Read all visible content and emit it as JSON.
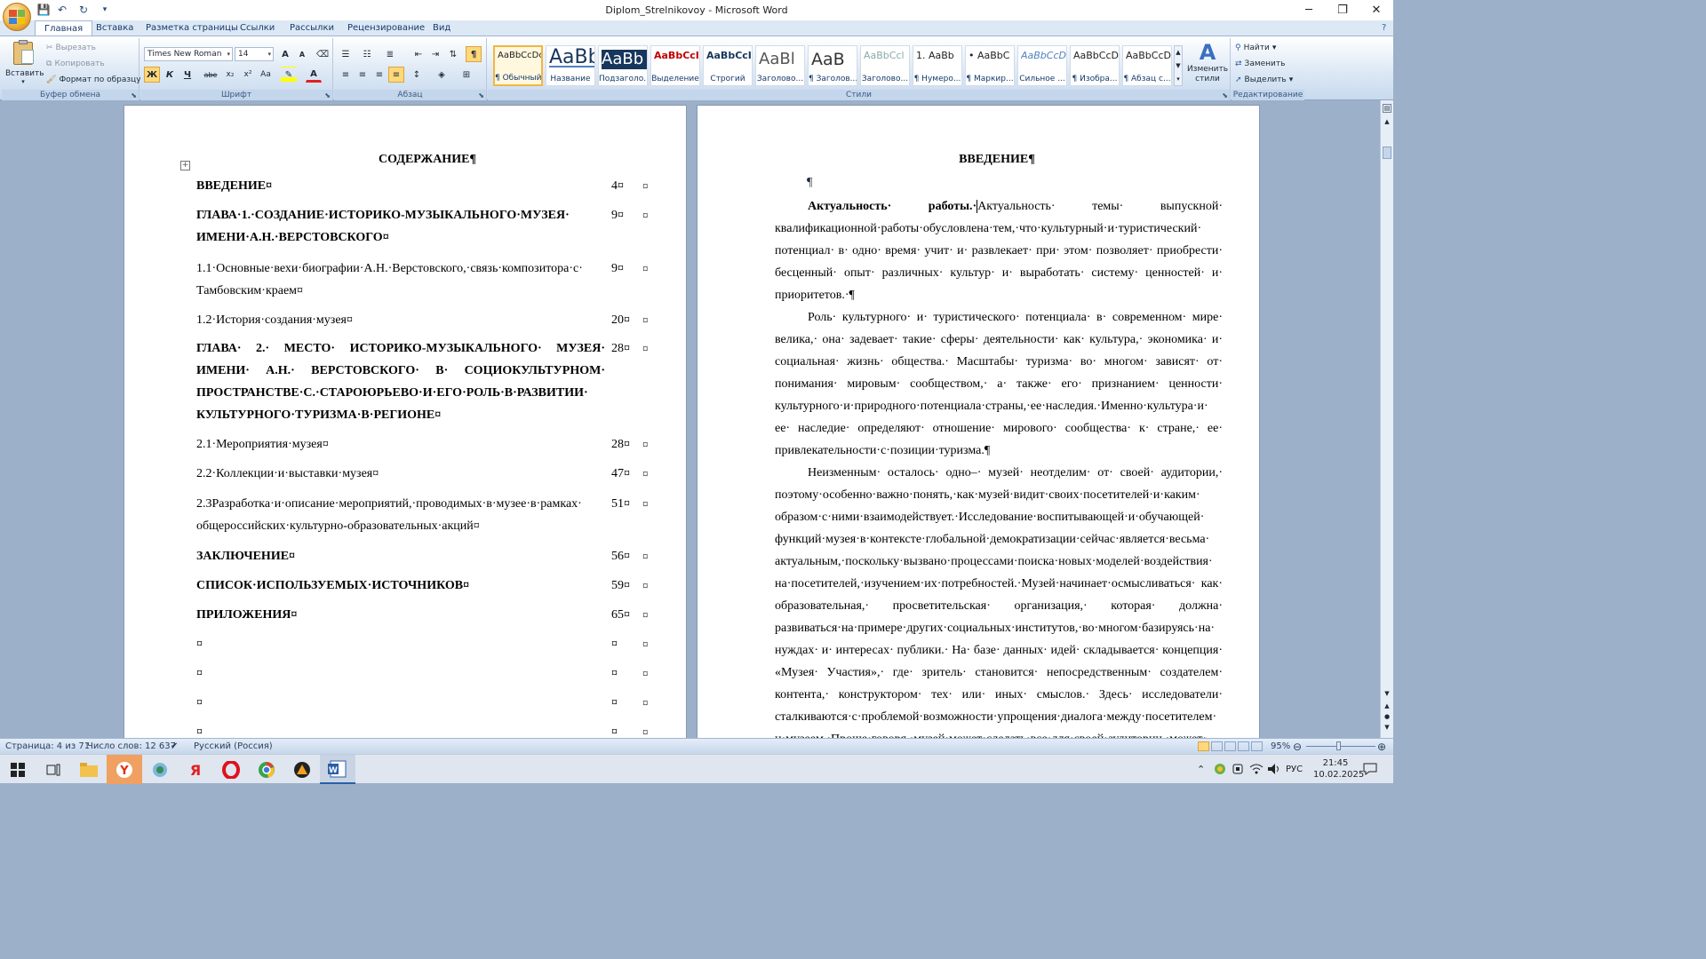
{
  "window": {
    "title": "Diplom_Strelnikovoy - Microsoft Word",
    "minimize_glyph": "─",
    "restore_glyph": "❐",
    "close_glyph": "✕",
    "qat_save": "💾",
    "qat_undo": "↶",
    "qat_redo": "↻",
    "qat_more": "▾"
  },
  "tabs": [
    {
      "label": "Главная",
      "active": true
    },
    {
      "label": "Вставка"
    },
    {
      "label": "Разметка страницы"
    },
    {
      "label": "Ссылки"
    },
    {
      "label": "Рассылки"
    },
    {
      "label": "Рецензирование"
    },
    {
      "label": "Вид"
    }
  ],
  "clipboard": {
    "group_label": "Буфер обмена",
    "paste": "Вставить",
    "cut": "Вырезать",
    "copy": "Копировать",
    "format_painter": "Формат по образцу"
  },
  "font": {
    "group_label": "Шрифт",
    "font_name": "Times New Roman",
    "font_size": "14",
    "grow": "A",
    "shrink": "A",
    "bold": "Ж",
    "italic": "К",
    "underline": "Ч",
    "strike": "abe",
    "sub": "x₂",
    "sup": "x²",
    "case": "Aa",
    "color": "A"
  },
  "paragraph": {
    "group_label": "Абзац",
    "pilcrow": "¶"
  },
  "styles": {
    "group_label": "Стили",
    "change_styles": "Изменить стили",
    "items": [
      {
        "sample": "AaBbCcDc",
        "name": "¶ Обычный"
      },
      {
        "sample": "AaBb",
        "name": "Название"
      },
      {
        "sample": "AaBb",
        "name": "Подзаголо..."
      },
      {
        "sample": "AaBbCcI",
        "name": "Выделение"
      },
      {
        "sample": "AaBbCcI",
        "name": "Строгий"
      },
      {
        "sample": "AaBl",
        "name": "Заголово..."
      },
      {
        "sample": "AaB",
        "name": "¶ Заголов..."
      },
      {
        "sample": "AaBbCcl",
        "name": "Заголово..."
      },
      {
        "sample": "1. AaBb",
        "name": "¶ Нумеро..."
      },
      {
        "sample": "• AaBbC",
        "name": "¶ Маркир..."
      },
      {
        "sample": "AaBbCcD",
        "name": "Сильное ..."
      },
      {
        "sample": "AaBbCcD",
        "name": "¶ Изобра..."
      },
      {
        "sample": "AaBbCcD",
        "name": "¶ Абзац с..."
      }
    ]
  },
  "editing": {
    "group_label": "Редактирование",
    "find": "Найти",
    "replace": "Заменить",
    "select": "Выделить"
  },
  "left_page": {
    "heading": "СОДЕРЖАНИЕ¶",
    "toc": [
      {
        "text": "ВВЕДЕНИЕ¤",
        "page": "4¤",
        "bold": true
      },
      {
        "text": "ГЛАВА·1.·СОЗДАНИЕ·ИСТОРИКО-МУЗЫКАЛЬНОГО·МУЗЕЯ· ИМЕНИ·А.Н.·ВЕРСТОВСКОГО¤",
        "page": "9¤",
        "bold": true
      },
      {
        "text": "1.1·Основные·вехи·биографии·А.Н.·Верстовского,·связь·композитора·с· Тамбовским·краем¤",
        "page": "9¤",
        "bold": false
      },
      {
        "text": "1.2·История·создания·музея¤",
        "page": "20¤",
        "bold": false
      },
      {
        "text": "ГЛАВА· 2.· МЕСТО· ИСТОРИКО-МУЗЫКАЛЬНОГО· МУЗЕЯ· ИМЕНИ· А.Н.· ВЕРСТОВСКОГО· В· СОЦИОКУЛЬТУРНОМ· ПРОСТРАНСТВЕ·С.·СТАРОЮРЬЕВО·И·ЕГО·РОЛЬ·В·РАЗВИТИИ· КУЛЬТУРНОГО·ТУРИЗМА·В·РЕГИОНЕ¤",
        "page": "28¤",
        "bold": true
      },
      {
        "text": "2.1·Мероприятия·музея¤",
        "page": "28¤",
        "bold": false
      },
      {
        "text": "2.2·Коллекции·и·выставки·музея¤",
        "page": "47¤",
        "bold": false
      },
      {
        "text": "2.3Разработка·и·описание·мероприятий,·проводимых·в·музее·в·рамках· общероссийских·культурно-образовательных·акций¤",
        "page": "51¤",
        "bold": false
      },
      {
        "text": "ЗАКЛЮЧЕНИЕ¤",
        "page": "56¤",
        "bold": true
      },
      {
        "text": "СПИСОК·ИСПОЛЬЗУЕМЫХ·ИСТОЧНИКОВ¤",
        "page": "59¤",
        "bold": true
      },
      {
        "text": "ПРИЛОЖЕНИЯ¤",
        "page": "65¤",
        "bold": true
      },
      {
        "text": "¤",
        "page": "¤",
        "bold": false
      },
      {
        "text": "¤",
        "page": "¤",
        "bold": false
      },
      {
        "text": "¤",
        "page": "¤",
        "bold": false
      },
      {
        "text": "¤",
        "page": "¤",
        "bold": false
      }
    ],
    "end_cell": "¤"
  },
  "right_page": {
    "heading": "ВВЕДЕНИЕ¶",
    "empty_para": "¶",
    "p1_bold": "Актуальность· работы.·",
    "p1": "Актуальность· темы· выпускной· квалификационной·работы·обусловлена·тем,·что·культурный·и·туристический· потенциал· в· одно· время· учит· и· развлекает· при· этом· позволяет· приобрести· бесценный· опыт· различных· культур· и· выработать· систему· ценностей· и· приоритетов.·¶",
    "p2": "Роль· культурного· и· туристического· потенциала· в· современном· мире· велика,· она· задевает· такие· сферы· деятельности· как· культура,· экономика· и· социальная· жизнь· общества.· Масштабы· туризма· во· многом· зависят· от· понимания· мировым· сообществом,· а· также· его· признанием· ценности· культурного·и·природного·потенциала·страны,·ее·наследия.·Именно·культура·и· ее· наследие· определяют· отношение· мирового· сообщества· к· стране,· ее· привлекательности·с·позиции·туризма.¶",
    "p3": "Неизменным· осталось· одно–· музей· неотделим· от· своей· аудитории,· поэтому·особенно·важно·понять,·как·музей·видит·своих·посетителей·и·каким· образом·с·ними·взаимодействует.·Исследование·воспитывающей·и·обучающей· функций·музея·в·контексте·глобальной·демократизации·сейчас·является·весьма· актуальным,·поскольку·вызвано·процессами·поиска·новых·моделей·воздействия· на·посетителей,·изучением·их·потребностей.·Музей·начинает·осмысливаться· как· образовательная,· просветительская· организация,· которая· должна· развиваться·на·примере·других·социальных·институтов,·во·многом·базируясь·на· нуждах· и· интересах· публики.· На· базе· данных· идей· складывается· концепция· «Музея· Участия»,· где· зритель· становится· непосредственным· создателем· контента,· конструктором· тех· или· иных· смыслов.· Здесь· исследователи· сталкиваются·с·проблемой·возможности·упрощения·диалога·между·посетителем· и·музеем.·Проще·говоря,·музей·может·сделать·все·для·своей·аудитории,·может·"
  },
  "status": {
    "page": "Страница: 4 из 71",
    "words": "Число слов: 12 637",
    "lang": "Русский (Россия)",
    "zoom": "95%",
    "zoom_minus": "⊖",
    "zoom_plus": "⊕"
  },
  "tray": {
    "lang": "РУС",
    "time": "21:45",
    "date": "10.02.2025"
  }
}
